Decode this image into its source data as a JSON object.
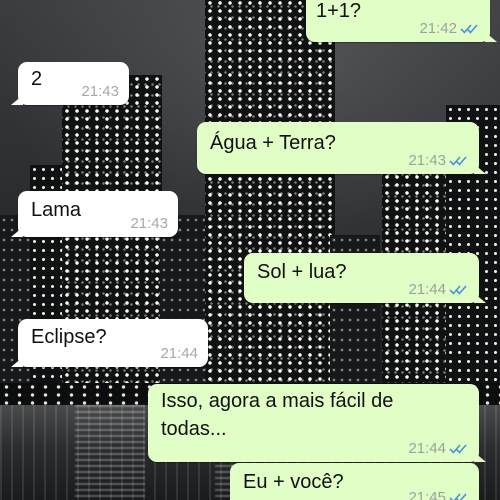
{
  "colors": {
    "outgoing_bubble": "#e1fec6",
    "incoming_bubble": "#ffffff",
    "read_check": "#4a90e2",
    "timestamp": "#9aa39a"
  },
  "messages": [
    {
      "direction": "outgoing",
      "lines": [
        "1+1?"
      ],
      "time": "21:42",
      "status_icon": "double-check-read-icon"
    },
    {
      "direction": "incoming",
      "lines": [
        "2"
      ],
      "time": "21:43"
    },
    {
      "direction": "outgoing",
      "lines": [
        "Água + Terra?"
      ],
      "time": "21:43",
      "status_icon": "double-check-read-icon"
    },
    {
      "direction": "incoming",
      "lines": [
        "Lama"
      ],
      "time": "21:43"
    },
    {
      "direction": "outgoing",
      "lines": [
        "Sol + lua?"
      ],
      "time": "21:44",
      "status_icon": "double-check-read-icon"
    },
    {
      "direction": "incoming",
      "lines": [
        "Eclipse?"
      ],
      "time": "21:44"
    },
    {
      "direction": "outgoing",
      "lines": [
        "Isso, agora a mais fácil de",
        "todas..."
      ],
      "time": "21:44",
      "status_icon": "double-check-read-icon"
    },
    {
      "direction": "outgoing",
      "lines": [
        "Eu + você?"
      ],
      "time": "21:45",
      "status_icon": "double-check-read-icon"
    }
  ]
}
